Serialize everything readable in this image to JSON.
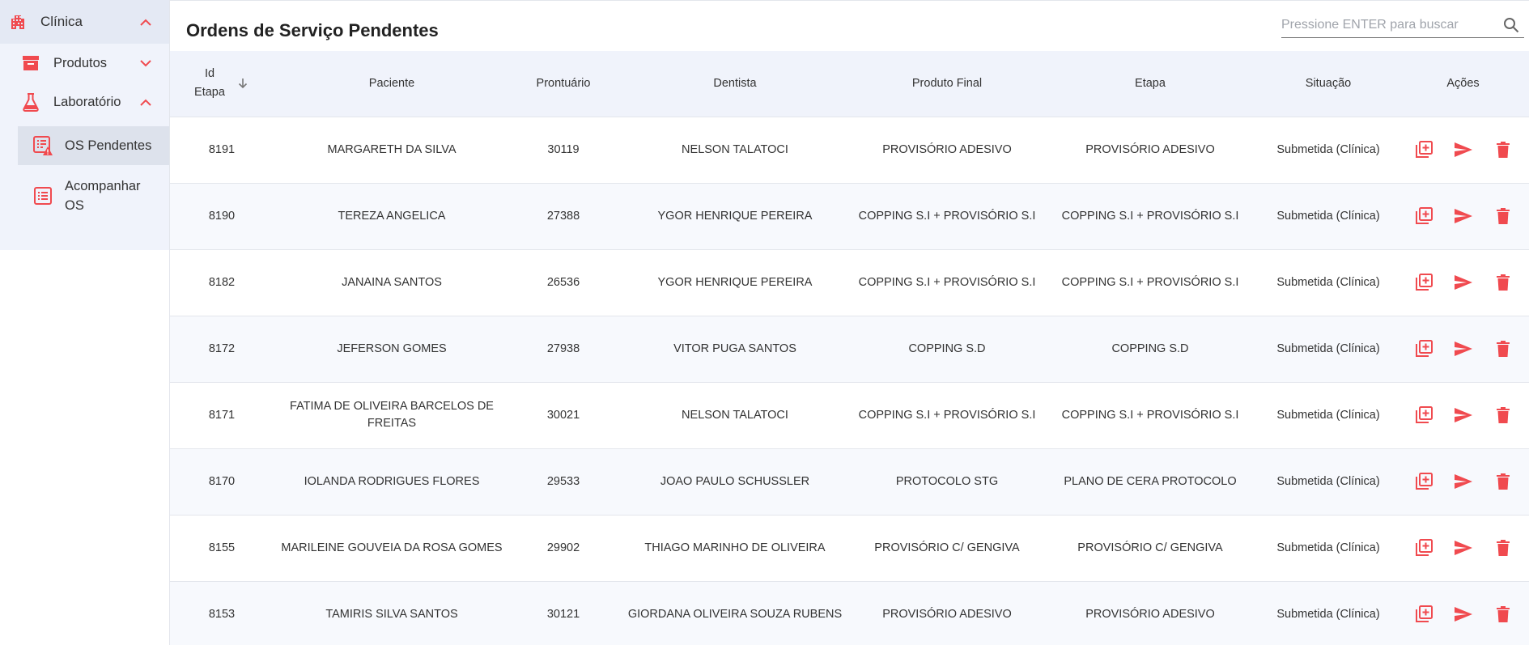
{
  "colors": {
    "accent": "#f04a4f",
    "sidebar_bg": "#f0f3fb",
    "header_bg": "#f0f3fb"
  },
  "sidebar": {
    "groups": [
      {
        "label": "Clínica",
        "icon": "building-icon",
        "chevron": "chevron-up-icon"
      },
      {
        "label": "Produtos",
        "icon": "archive-box-icon",
        "chevron": "chevron-down-icon"
      },
      {
        "label": "Laboratório",
        "icon": "flask-icon",
        "chevron": "chevron-up-icon"
      }
    ],
    "items": [
      {
        "label": "OS Pendentes",
        "icon": "list-warning-icon"
      },
      {
        "label": "Acompanhar OS",
        "icon": "list-icon"
      }
    ]
  },
  "page": {
    "title": "Ordens de Serviço Pendentes"
  },
  "search": {
    "placeholder": "Pressione ENTER para buscar",
    "value": ""
  },
  "table": {
    "headers": [
      "Id Etapa",
      "Paciente",
      "Prontuário",
      "Dentista",
      "Produto Final",
      "Etapa",
      "Situação",
      "Ações"
    ],
    "rows": [
      {
        "id": "8191",
        "paciente": "MARGARETH DA SILVA",
        "prontuario": "30119",
        "dentista": "NELSON TALATOCI",
        "produto": "PROVISÓRIO ADESIVO",
        "etapa": "PROVISÓRIO ADESIVO",
        "situacao": "Submetida (Clínica)"
      },
      {
        "id": "8190",
        "paciente": "TEREZA ANGELICA",
        "prontuario": "27388",
        "dentista": "YGOR HENRIQUE PEREIRA",
        "produto": "COPPING S.I + PROVISÓRIO S.I",
        "etapa": "COPPING S.I + PROVISÓRIO S.I",
        "situacao": "Submetida (Clínica)"
      },
      {
        "id": "8182",
        "paciente": "JANAINA SANTOS",
        "prontuario": "26536",
        "dentista": "YGOR HENRIQUE PEREIRA",
        "produto": "COPPING S.I + PROVISÓRIO S.I",
        "etapa": "COPPING S.I + PROVISÓRIO S.I",
        "situacao": "Submetida (Clínica)"
      },
      {
        "id": "8172",
        "paciente": "JEFERSON GOMES",
        "prontuario": "27938",
        "dentista": "VITOR PUGA SANTOS",
        "produto": "COPPING S.D",
        "etapa": "COPPING S.D",
        "situacao": "Submetida (Clínica)"
      },
      {
        "id": "8171",
        "paciente": "FATIMA DE OLIVEIRA BARCELOS DE FREITAS",
        "prontuario": "30021",
        "dentista": "NELSON TALATOCI",
        "produto": "COPPING S.I + PROVISÓRIO S.I",
        "etapa": "COPPING S.I + PROVISÓRIO S.I",
        "situacao": "Submetida (Clínica)"
      },
      {
        "id": "8170",
        "paciente": "IOLANDA RODRIGUES FLORES",
        "prontuario": "29533",
        "dentista": "JOAO PAULO SCHUSSLER",
        "produto": "PROTOCOLO STG",
        "etapa": "PLANO DE CERA PROTOCOLO",
        "situacao": "Submetida (Clínica)"
      },
      {
        "id": "8155",
        "paciente": "MARILEINE GOUVEIA DA ROSA GOMES",
        "prontuario": "29902",
        "dentista": "THIAGO MARINHO DE OLIVEIRA",
        "produto": "PROVISÓRIO C/ GENGIVA",
        "etapa": "PROVISÓRIO C/ GENGIVA",
        "situacao": "Submetida (Clínica)"
      },
      {
        "id": "8153",
        "paciente": "TAMIRIS SILVA SANTOS",
        "prontuario": "30121",
        "dentista": "GIORDANA OLIVEIRA SOUZA RUBENS",
        "produto": "PROVISÓRIO ADESIVO",
        "etapa": "PROVISÓRIO ADESIVO",
        "situacao": "Submetida (Clínica)"
      }
    ],
    "row_actions": [
      "add-copy-icon",
      "send-icon",
      "trash-icon"
    ]
  }
}
